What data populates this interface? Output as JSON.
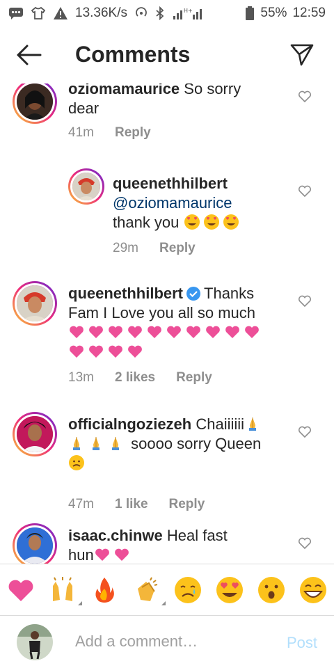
{
  "status_bar": {
    "speed": "13.36K/s",
    "battery": "55%",
    "time": "12:59",
    "icons": [
      "message-icon",
      "tshirt-icon",
      "warning-icon",
      "hotspot-icon",
      "bluetooth-icon",
      "signal-icon",
      "battery-icon"
    ]
  },
  "header": {
    "title": "Comments",
    "back_icon": "arrow-left-icon",
    "send_icon": "paper-plane-icon"
  },
  "comments": [
    {
      "username": "oziomamaurice",
      "text_line1": "So sorry",
      "text_line2": "dear",
      "time": "41m",
      "reply": "Reply"
    },
    {
      "username": "queenethhilbert",
      "mention": "@oziomamaurice",
      "text": "thank you",
      "emojis": [
        "heart-eyes",
        "heart-eyes",
        "heart-eyes"
      ],
      "time": "29m",
      "reply": "Reply"
    },
    {
      "username": "queenethhilbert",
      "text_line1": "Thanks",
      "text_line2": "Fam I Love you all so much",
      "hearts": 14,
      "time": "13m",
      "likes": "2 likes",
      "reply": "Reply"
    },
    {
      "username": "officialngoziezeh",
      "text_line1": "Chaiiiiii",
      "text_line2": "soooo sorry Queen",
      "time": "47m",
      "likes": "1 like",
      "reply": "Reply"
    },
    {
      "username": "isaac.chinwe",
      "text_line1": "Heal fast",
      "text_line2": "hun"
    }
  ],
  "reactions": [
    "heart",
    "raising-hands",
    "fire",
    "clapping-hands",
    "crying-face",
    "heart-eyes",
    "surprised-face",
    "laughing-face"
  ],
  "composer": {
    "placeholder": "Add a comment…",
    "post": "Post"
  },
  "colors": {
    "text": "#262626",
    "meta": "#8e8e8e",
    "mention": "#00376b",
    "heart": "#ed4f98",
    "post": "#b2dffc"
  }
}
